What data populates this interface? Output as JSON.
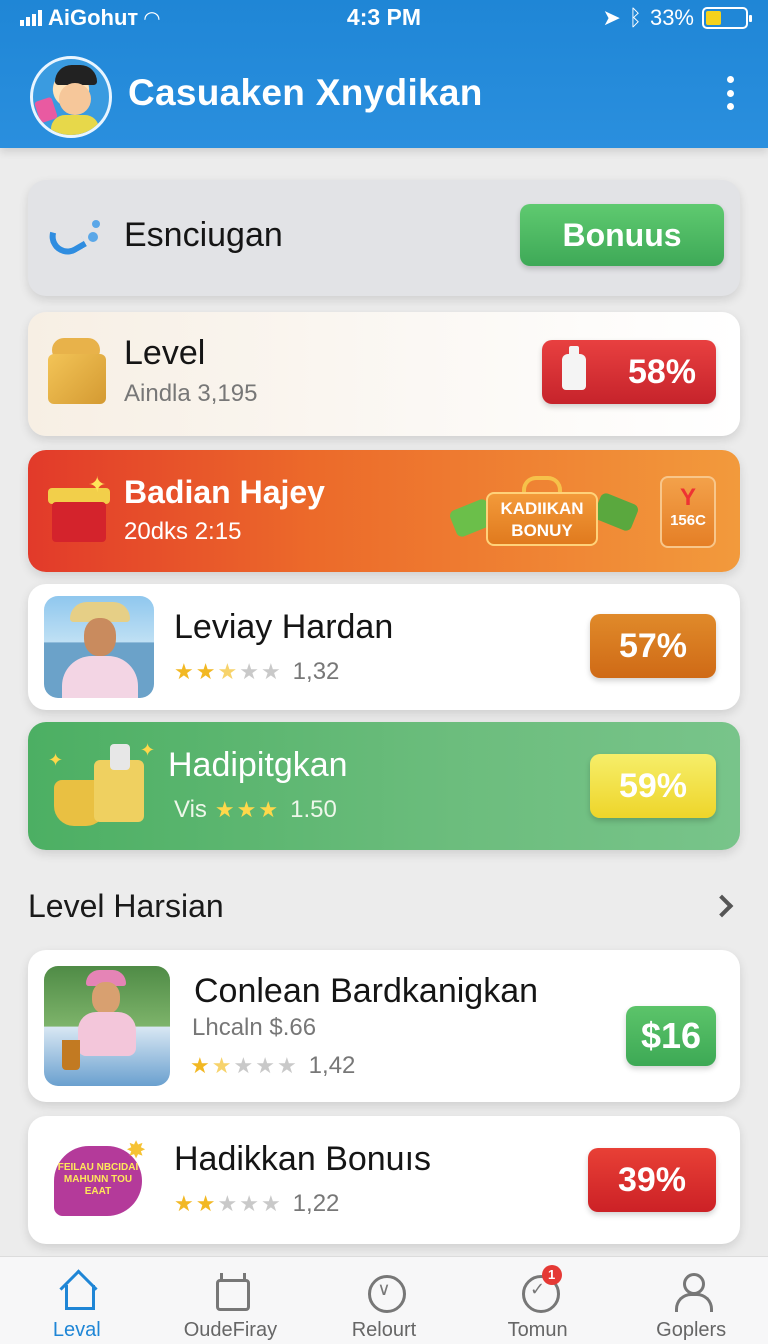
{
  "status_bar": {
    "carrier": "AiGohuт",
    "time": "4:3 PM",
    "battery": "33%"
  },
  "header": {
    "title": "Casuaken Xnydikan"
  },
  "cards": {
    "top": {
      "title": "Esnciugan",
      "button": "Bonuus"
    },
    "level": {
      "title": "Level",
      "subtitle": "Aindla 3,195",
      "badge": "58%"
    },
    "promo": {
      "title": "Badian Hajey",
      "subtitle": "20dks 2:15",
      "promo_label_1": "KADIIKAN",
      "promo_label_2": "BONUY",
      "tag_text": "156C"
    },
    "leviay": {
      "title": "Leviay Hardan",
      "rating": "1,32",
      "badge": "57%"
    },
    "hadipit": {
      "title": "Hadipitgkan",
      "prefix": "Vis",
      "rating": "1.50",
      "badge": "59%"
    }
  },
  "section": {
    "title": "Level Harsian"
  },
  "list": [
    {
      "title": "Conlean Bardkanigkan",
      "subtitle": "Lhcaln $.66",
      "rating": "1,42",
      "badge": "$16"
    },
    {
      "title": "Hadikkan Bonuıs",
      "rating": "1,22",
      "badge": "39%",
      "bubble_text": "FEILAU NBCIDAI MAHUNN TOU EAAT"
    }
  ],
  "nav": [
    {
      "label": "Leval",
      "icon": "home-icon",
      "active": true
    },
    {
      "label": "OudeFiray",
      "icon": "calendar-icon"
    },
    {
      "label": "Relourt",
      "icon": "circle-icon"
    },
    {
      "label": "Tomun",
      "icon": "check-icon",
      "notification": "1"
    },
    {
      "label": "Goplers",
      "icon": "user-icon"
    }
  ],
  "colors": {
    "header": "#1f86d6",
    "green": "#4caf63",
    "red": "#d6262e",
    "orange": "#e07a1e",
    "yellow": "#f2d33a"
  }
}
